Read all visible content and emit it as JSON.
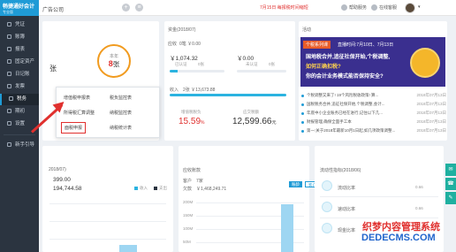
{
  "header": {
    "logo_text": "畅捷通好会计",
    "logo_sub": "专业版",
    "company": "广告公司",
    "notice": "7月15日 每报税时间缩短",
    "help_label": "帮助服务",
    "online_label": "在线客服"
  },
  "sidebar": {
    "items": [
      {
        "label": "凭证"
      },
      {
        "label": "账簿"
      },
      {
        "label": "报表"
      },
      {
        "label": "固定资产"
      },
      {
        "label": "日记账"
      },
      {
        "label": "发票"
      },
      {
        "label": "税务"
      },
      {
        "label": "期初"
      },
      {
        "label": "设置"
      },
      {
        "label": "新手引导"
      }
    ],
    "active_index": 6
  },
  "invoice_card": {
    "partial_label": "张",
    "ring_label": "本年",
    "ring_value": "8",
    "ring_unit": "张"
  },
  "tax_menu": {
    "items": [
      {
        "label": "增值税申报表"
      },
      {
        "label": "税负监控表"
      },
      {
        "label": "所得税汇算调整"
      },
      {
        "label": "纳税监控表"
      },
      {
        "label": "面税申报"
      },
      {
        "label": "纳税统计表"
      }
    ],
    "highlight_index": 4
  },
  "finance_card": {
    "title": "资金(2018/07)",
    "receivable_label": "应收",
    "receivable_value": "0笔 ￥0.00",
    "amount_left": "￥1,074.32",
    "amount_right": "￥0.00",
    "sub_left_a": "已认证",
    "sub_left_b": "0张",
    "sub_right_a": "未认证",
    "sub_right_b": "0张",
    "income_label": "收入",
    "income_value": "2张 ￥13,673.88",
    "tax_rate_label": "增值税税负",
    "tax_rate_value": "15.59",
    "tax_rate_unit": "%",
    "total_label": "应交税额",
    "total_value": "12,599.66",
    "total_unit": "元"
  },
  "news_card": {
    "title": "活动",
    "banner_chip": "个税系列课",
    "banner_date": "直播时间:7月10日、7月13日",
    "banner_line1": "国地税合并,追征社保开始,个税调整,",
    "banner_line2": "如何正确扣税? ",
    "banner_line3": "你的会计业务模式能否保持安全?",
    "items": [
      {
        "text": "个税调整又来了! 19个风险税收政策! 算...",
        "date": "2018年07月13日"
      },
      {
        "text": "国税税务合并,追征社保开始,个税调整,会计...",
        "date": "2018年07月13日"
      },
      {
        "text": "年底中小企业账务已经在进行,记住以下几...",
        "date": "2018年07月13日"
      },
      {
        "text": "财报管理,确保全面手工本",
        "date": "2018年07月13日"
      },
      {
        "text": "第一:关于2018年最新10月1日起,如几项政策调整...",
        "date": "2018年07月13日"
      }
    ]
  },
  "cashflow_card": {
    "title": "2018/07)",
    "amount_a": "399.00",
    "amount_b": "194,744.58",
    "legend_income": "收入",
    "legend_expense": "支出"
  },
  "receivable_card": {
    "title": "应收账款",
    "customer_label": "客户",
    "customer_value": "7家",
    "owed_label": "欠款",
    "owed_value": "￥1,468,249.71",
    "seg_on": "账龄",
    "seg_off": "客户",
    "axis_ticks": [
      "200M",
      "150M",
      "100M",
      "50M"
    ]
  },
  "runtime_card": {
    "title": "流动性指标(2018/06)",
    "rows": [
      {
        "label": "流动比率",
        "value": "0.66"
      },
      {
        "label": "速动比率",
        "value": "0.66"
      },
      {
        "label": "现金比率",
        "value": "0.58"
      }
    ]
  },
  "watermark": {
    "line1": "织梦内容管理系统",
    "line2": "DEDECMS.COM"
  },
  "colors": {
    "brand": "#1f9bd6",
    "sidebar": "#2b3440",
    "alert": "#e0302e",
    "ring": "#f19b1f"
  }
}
